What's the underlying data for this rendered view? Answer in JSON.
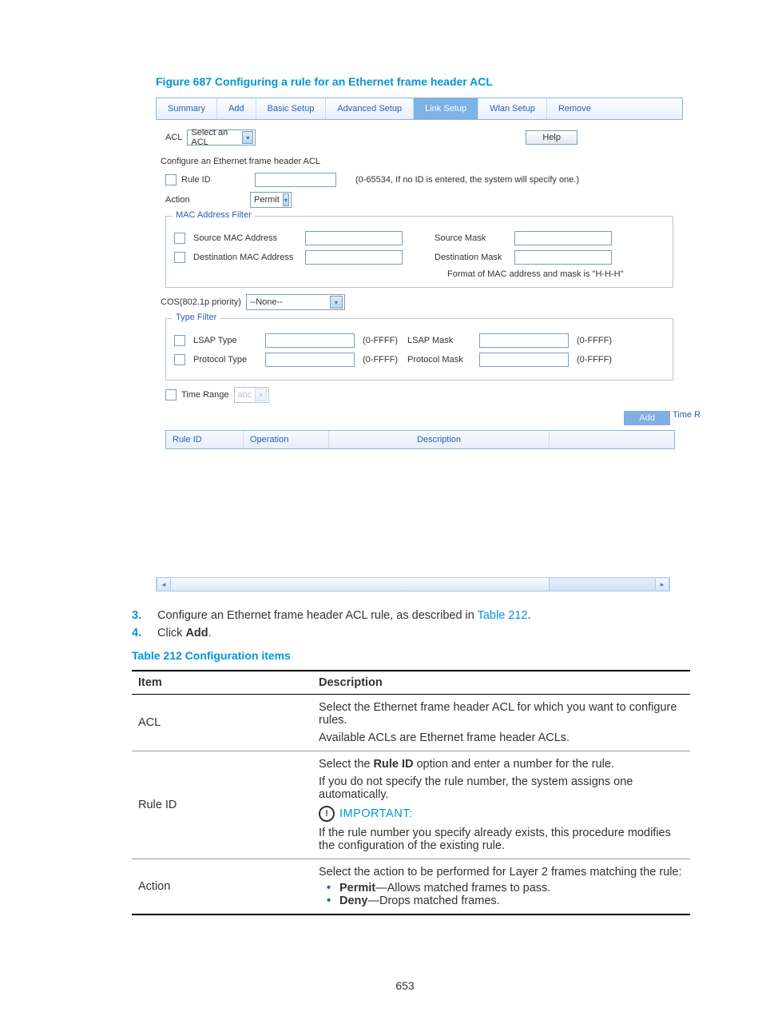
{
  "figure_title": "Figure 687 Configuring a rule for an Ethernet frame header ACL",
  "screenshot": {
    "tabs": [
      "Summary",
      "Add",
      "Basic Setup",
      "Advanced Setup",
      "Link Setup",
      "Wlan Setup",
      "Remove"
    ],
    "active_tab_index": 4,
    "acl_label": "ACL",
    "acl_select_value": "Select an ACL",
    "help_button": "Help",
    "section_title": "Configure an Ethernet frame header ACL",
    "ruleid_label": "Rule ID",
    "ruleid_hint": "(0-65534, If no ID is entered, the system will specify one.)",
    "action_label": "Action",
    "action_value": "Permit",
    "mac_fieldset": "MAC Address Filter",
    "source_mac": "Source MAC Address",
    "source_mask": "Source Mask",
    "dest_mac": "Destination MAC Address",
    "dest_mask": "Destination Mask",
    "mac_hint": "Format of MAC address and mask is \"H-H-H\"",
    "cos_label": "COS(802.1p priority)",
    "cos_value": "--None--",
    "type_fieldset": "Type Filter",
    "lsap_type": "LSAP Type",
    "lsap_mask": "LSAP Mask",
    "protocol_type": "Protocol Type",
    "protocol_mask": "Protocol Mask",
    "range_hint": "(0-FFFF)",
    "timerange_label": "Time Range",
    "timerange_value": "abc",
    "add_button": "Add",
    "result_headers": {
      "ruleid": "Rule ID",
      "operation": "Operation",
      "description": "Description",
      "timer": "Time R"
    }
  },
  "steps": [
    {
      "num": "3.",
      "text_pre": "Configure an Ethernet frame header ACL rule, as described in ",
      "link": "Table 212",
      "text_post": "."
    },
    {
      "num": "4.",
      "text_pre": "Click ",
      "bold": "Add",
      "text_post": "."
    }
  ],
  "table_title": "Table 212 Configuration items",
  "table": {
    "headers": {
      "item": "Item",
      "desc": "Description"
    },
    "rows": {
      "acl": {
        "item": "ACL",
        "lines": [
          "Select the Ethernet frame header ACL for which you want to configure rules.",
          "Available ACLs are Ethernet frame header ACLs."
        ]
      },
      "ruleid": {
        "item": "Rule ID",
        "line1_pre": "Select the ",
        "line1_bold": "Rule ID",
        "line1_post": " option and enter a number for the rule.",
        "line2": "If you do not specify the rule number, the system assigns one automatically.",
        "important_label": "IMPORTANT:",
        "line3": "If the rule number you specify already exists, this procedure modifies the configuration of the existing rule."
      },
      "action": {
        "item": "Action",
        "line1": "Select the action to be performed for Layer 2 frames matching the rule:",
        "bullets": [
          {
            "bold": "Permit",
            "rest": "—Allows matched frames to pass."
          },
          {
            "bold": "Deny",
            "rest": "—Drops matched frames."
          }
        ]
      }
    }
  },
  "page_number": "653"
}
